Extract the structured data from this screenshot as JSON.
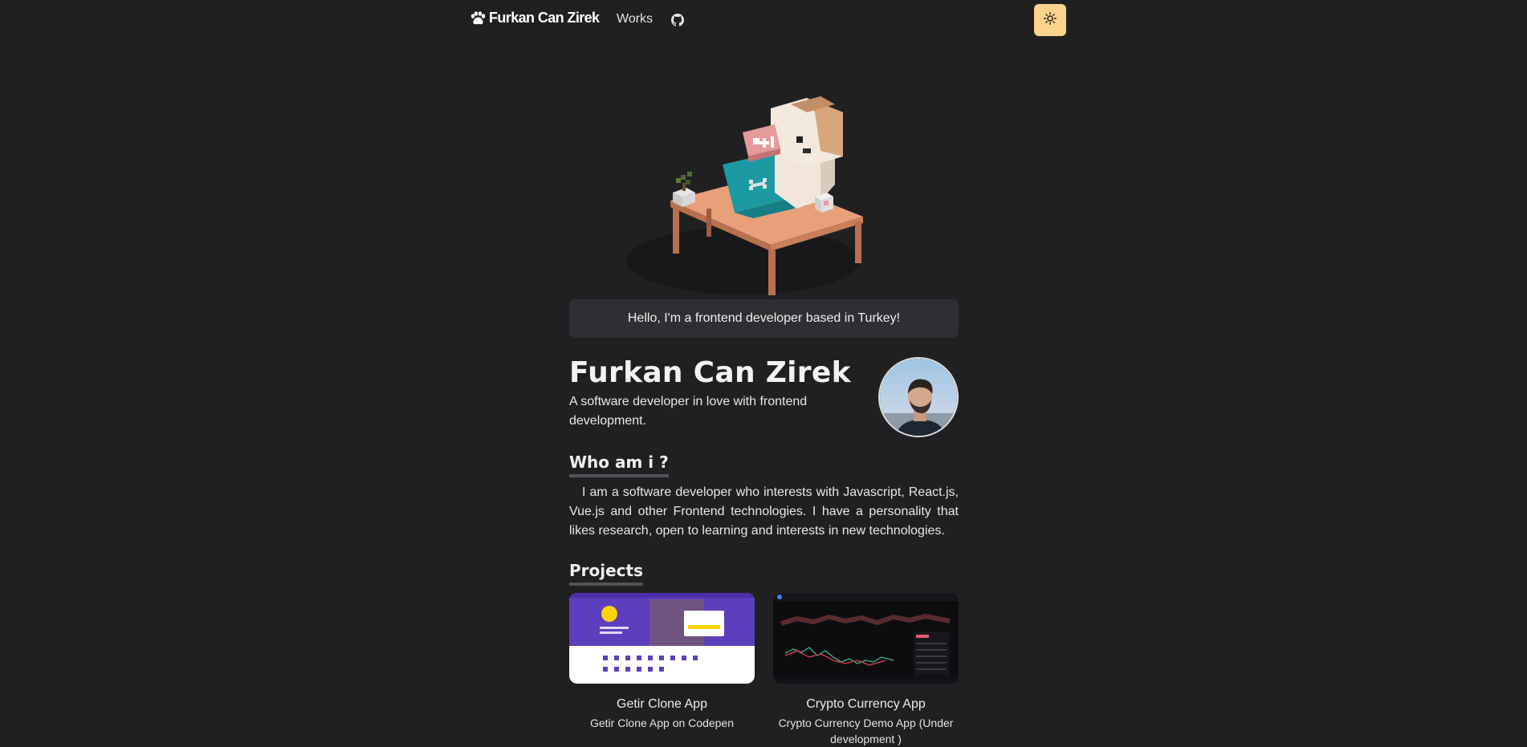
{
  "nav": {
    "brand": "Furkan Can Zirek",
    "links": [
      {
        "label": "Works"
      }
    ],
    "github_icon": "github-icon",
    "theme_icon": "sun-icon",
    "theme_button_color": "#fbd38d"
  },
  "hero": {
    "greeting": "Hello, I'm a frontend developer based in Turkey!"
  },
  "profile": {
    "name": "Furkan Can Zirek",
    "tagline": "A software developer in love with frontend development."
  },
  "about": {
    "heading": "Who am i ?",
    "text": "I am a software developer who interests with Javascript, React.js, Vue.js and other Frontend technologies. I have a personality that likes research, open to learning and interests in new technologies."
  },
  "projects": {
    "heading": "Projects",
    "items": [
      {
        "title": "Getir Clone App",
        "description": "Getir Clone App on Codepen"
      },
      {
        "title": "Crypto Currency App",
        "description": "Crypto Currency Demo App (Under development )"
      }
    ]
  }
}
